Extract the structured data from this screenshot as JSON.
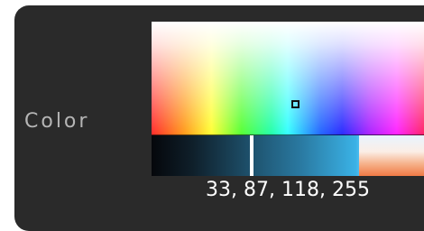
{
  "color_field": {
    "label": "Color",
    "value_text": "33, 87, 118, 255",
    "rgba": {
      "r": 33,
      "g": 87,
      "b": 118,
      "a": 255
    }
  },
  "colors": {
    "panel_background": "#2a2a2a",
    "label_text": "#b5b5b5",
    "value_text": "#ffffff",
    "selected_color": "#215776"
  },
  "picker": {
    "hue_marker_fraction_x": 0.53,
    "hue_marker_fraction_y": 0.73,
    "brightness_slider_fraction": 0.36
  }
}
